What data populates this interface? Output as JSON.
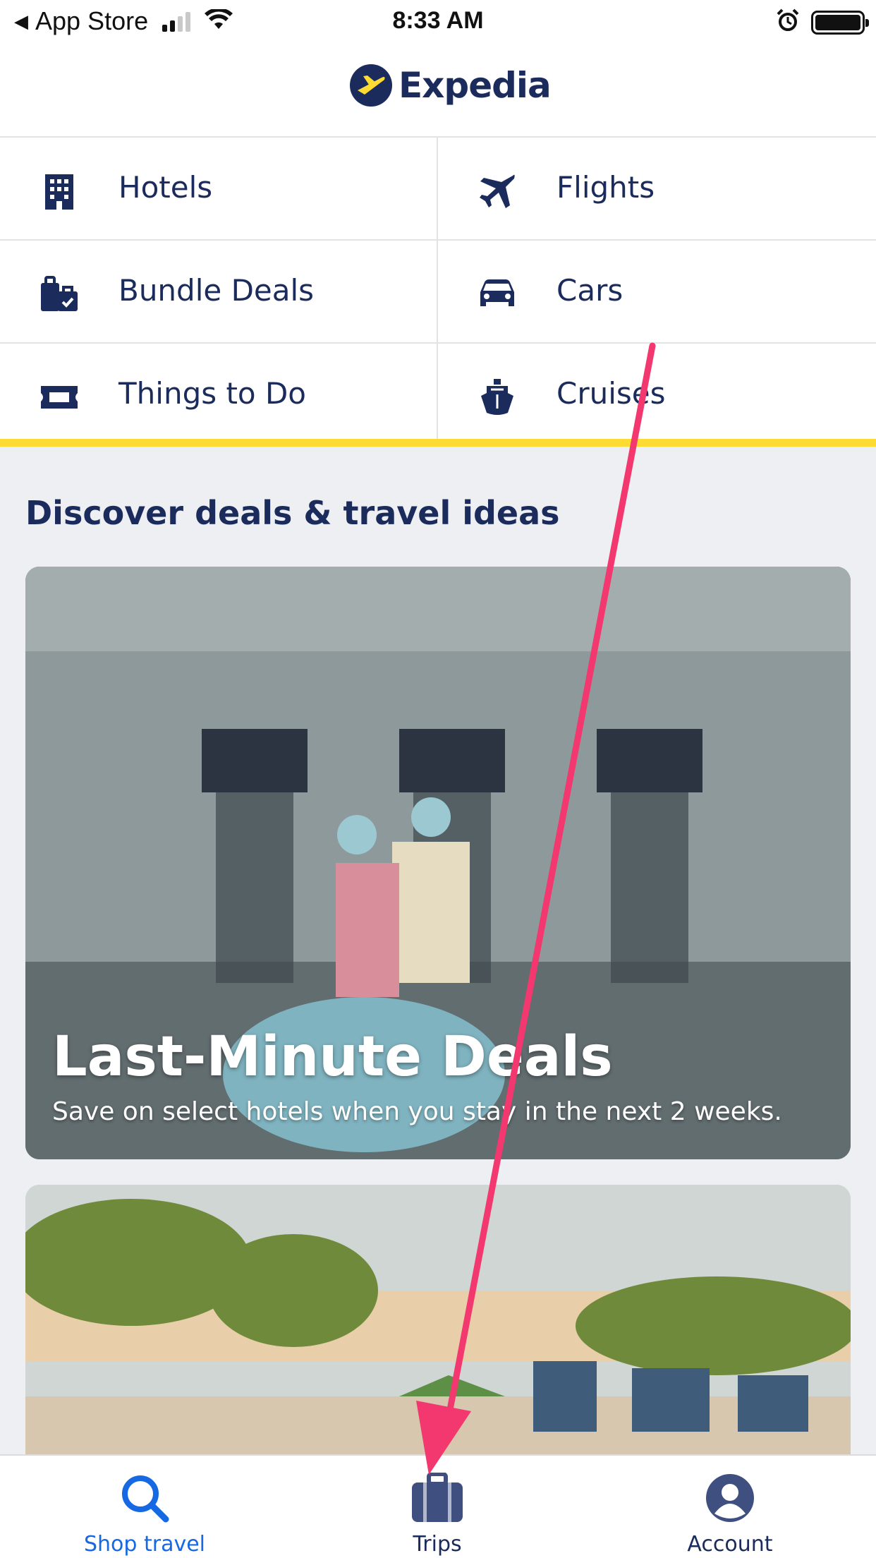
{
  "status_bar": {
    "back_label": "◀",
    "carrier": "App Store",
    "time": "8:33 AM"
  },
  "header": {
    "logo_text": "Expedia"
  },
  "categories": [
    {
      "label": "Hotels",
      "icon": "building-icon"
    },
    {
      "label": "Flights",
      "icon": "airplane-icon"
    },
    {
      "label": "Bundle Deals",
      "icon": "luggage-icon"
    },
    {
      "label": "Cars",
      "icon": "car-icon"
    },
    {
      "label": "Things to Do",
      "icon": "ticket-icon"
    },
    {
      "label": "Cruises",
      "icon": "ship-icon"
    }
  ],
  "discover": {
    "title": "Discover deals & travel ideas",
    "cards": [
      {
        "title": "Last-Minute Deals",
        "subtitle": "Save on select hotels when you stay in the next 2 weeks."
      },
      {
        "title": "",
        "subtitle": ""
      }
    ]
  },
  "tabbar": {
    "tabs": [
      {
        "label": "Shop travel",
        "icon": "search-icon",
        "active": true
      },
      {
        "label": "Trips",
        "icon": "suitcase-icon",
        "active": false
      },
      {
        "label": "Account",
        "icon": "account-icon",
        "active": false
      }
    ]
  },
  "colors": {
    "brand_navy": "#1a2b5c",
    "brand_yellow": "#fddb32",
    "active_tab": "#1668e3",
    "annotation_arrow": "#f2386e"
  }
}
